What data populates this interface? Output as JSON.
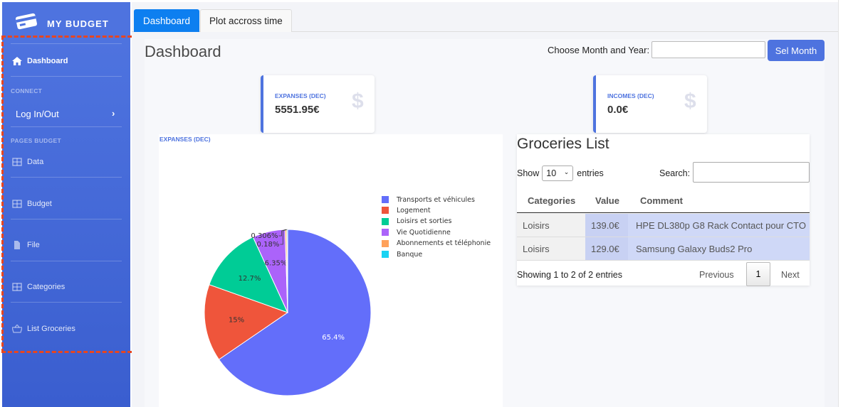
{
  "sidebar": {
    "brand": "MY BUDGET",
    "dashboard_label": "Dashboard",
    "heading_connect": "CONNECT",
    "login_label": "Log In/Out",
    "heading_pages": "PAGES BUDGET",
    "items": [
      {
        "label": "Data",
        "icon": "table-icon"
      },
      {
        "label": "Budget",
        "icon": "table-icon"
      },
      {
        "label": "File",
        "icon": "file-icon"
      },
      {
        "label": "Categories",
        "icon": "table-icon"
      },
      {
        "label": "List Groceries",
        "icon": "basket-icon"
      }
    ]
  },
  "tabs": [
    {
      "label": "Dashboard",
      "active": true
    },
    {
      "label": "Plot accross time",
      "active": false
    }
  ],
  "header": {
    "title": "Dashboard",
    "month_label": "Choose Month and Year:",
    "month_value": "",
    "sel_button": "Sel Month"
  },
  "cards": [
    {
      "title": "EXPANSES (DEC)",
      "value": "5551.95€",
      "icon": "dollar-icon"
    },
    {
      "title": "INCOMES (DEC)",
      "value": "0.0€",
      "icon": "dollar-icon"
    }
  ],
  "colors": {
    "accent": "#4e73df",
    "highlight": "#e8451e"
  },
  "chart_data": {
    "type": "pie",
    "title": "EXPANSES (DEC)",
    "categories": [
      "Transports et véhicules",
      "Logement",
      "Loisirs et sorties",
      "Vie Quotidienne",
      "Abonnements et téléphonie",
      "Banque"
    ],
    "values": [
      65.4,
      15,
      12.7,
      6.35,
      0.306,
      0.18
    ],
    "labels": [
      "65.4%",
      "15%",
      "12.7%",
      "6.35%",
      "0.306%",
      "0.18%"
    ],
    "colors": [
      "#636efa",
      "#ef553b",
      "#00cc96",
      "#ab63fa",
      "#ffa15a",
      "#19d3f3"
    ],
    "legend_position": "right"
  },
  "groceries": {
    "title": "Groceries List",
    "show_label": "Show",
    "show_value": "10",
    "entries_label": "entries",
    "search_label": "Search:",
    "search_value": "",
    "columns": [
      "Categories",
      "Value",
      "Comment"
    ],
    "rows": [
      [
        "Loisirs",
        "139.0€",
        "HPE DL380p G8 Rack Contact pour CTO"
      ],
      [
        "Loisirs",
        "129.0€",
        "Samsung Galaxy Buds2 Pro"
      ]
    ],
    "info": "Showing 1 to 2 of 2 entries",
    "prev": "Previous",
    "page": "1",
    "next": "Next"
  }
}
